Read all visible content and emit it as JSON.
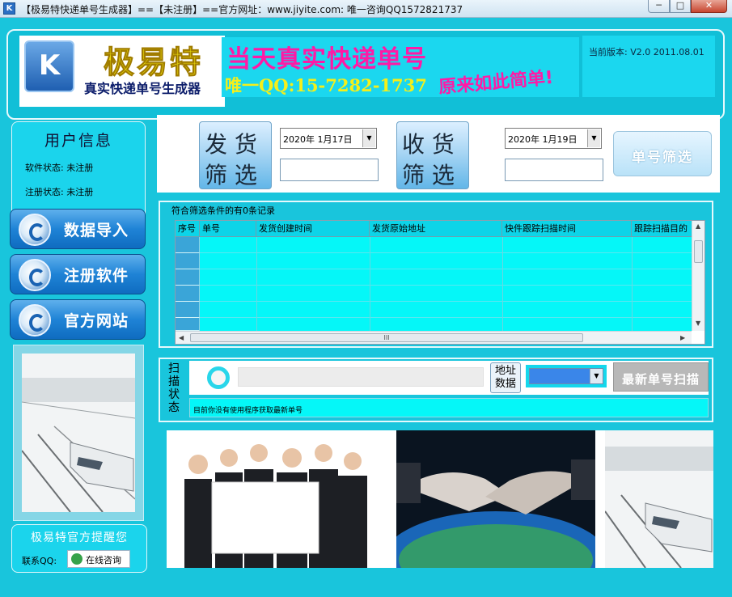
{
  "window": {
    "title": "【极易特快递单号生成器】==【未注册】==官方网址：www.jiyite.com:  唯一咨询QQ1572821737",
    "icon": "app-icon",
    "min_label": "─",
    "max_label": "□",
    "close_label": "✕"
  },
  "header": {
    "logo_letter": "K",
    "brand": "极易特",
    "subtitle": "真实快递单号生成器",
    "slogan_main": "当天真实快递单号",
    "slogan_qq": "唯一QQ:15-7282-1737",
    "slogan_side": "原来如此简单!",
    "version": "当前版本: V2.0 2011.08.01"
  },
  "user_info": {
    "title": "用户信息",
    "software_status": "软件状态: 未注册",
    "register_status": "注册状态: 未注册"
  },
  "side_buttons": [
    {
      "label": "数据导入",
      "icon": "refresh-arrow-icon"
    },
    {
      "label": "注册软件",
      "icon": "refresh-arrow-icon"
    },
    {
      "label": "官方网站",
      "icon": "refresh-arrow-icon"
    }
  ],
  "reminder": {
    "title": "极易特官方提醒您",
    "qq_label": "联系QQ:",
    "online_button": "在线咨询"
  },
  "filter": {
    "ship_filter_top": "发 货",
    "ship_filter_bottom": "筛 选",
    "ship_date": "2020年  1月17日",
    "receive_filter_top": "收 货",
    "receive_filter_bottom": "筛 选",
    "receive_date": "2020年  1月19日",
    "number_filter": "单号筛选"
  },
  "results": {
    "caption": "符合筛选条件的有0条记录",
    "columns": [
      "序号",
      "单号",
      "发货创建时间",
      "发货原始地址",
      "快件跟踪扫描时间",
      "跟踪扫描目的"
    ],
    "rows": 5,
    "hscroll_grip": "III"
  },
  "scan": {
    "label": "扫描状态",
    "address_button": "地址数据",
    "scan_button": "最新单号扫描",
    "status": "目前你没有使用程序获取最新单号"
  },
  "colors": {
    "frame": "#19c5dc",
    "grid_fill": "#05f7f8",
    "brand_yellow": "#f1e40b",
    "slogan_pink": "#ff1aa6"
  }
}
